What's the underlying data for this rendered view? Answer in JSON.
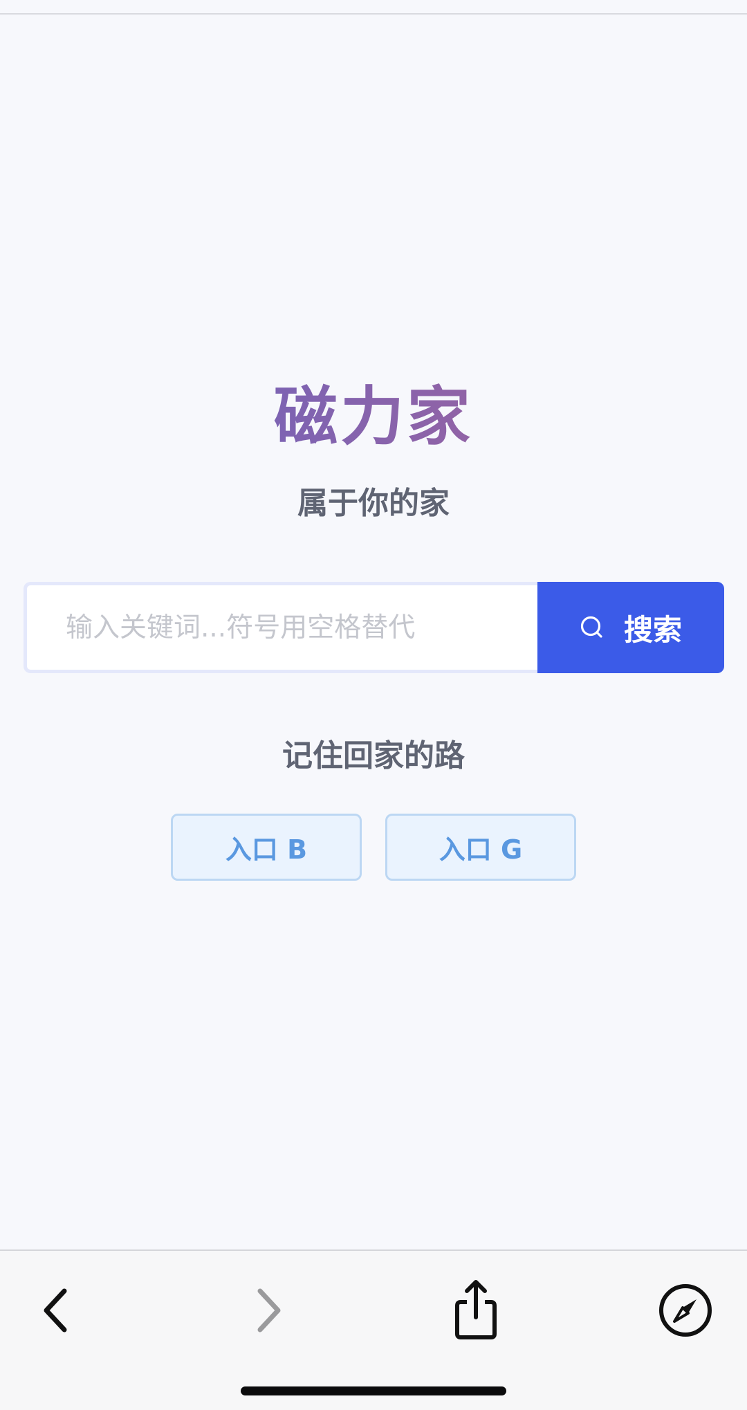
{
  "site": {
    "title": "磁力家",
    "subtitle": "属于你的家"
  },
  "search": {
    "placeholder": "输入关键词...符号用空格替代",
    "value": "",
    "button_label": "搜索",
    "button_icon": "search-icon"
  },
  "entries": {
    "heading": "记住回家的路",
    "items": [
      {
        "label": "入口 B"
      },
      {
        "label": "入口 G"
      }
    ]
  },
  "browser_toolbar": {
    "icons": [
      "chevron-left-icon",
      "chevron-right-icon",
      "share-icon",
      "compass-icon"
    ],
    "colors": {
      "active": "#111111",
      "disabled": "#9a9a9c"
    }
  },
  "colors": {
    "title_gradient": [
      "#7d63b2",
      "#9163a6"
    ],
    "accent": "#3b5be8",
    "entry_text": "#5a98e0",
    "entry_bg": "#eaf3fe",
    "background": "#f7f8fc"
  }
}
